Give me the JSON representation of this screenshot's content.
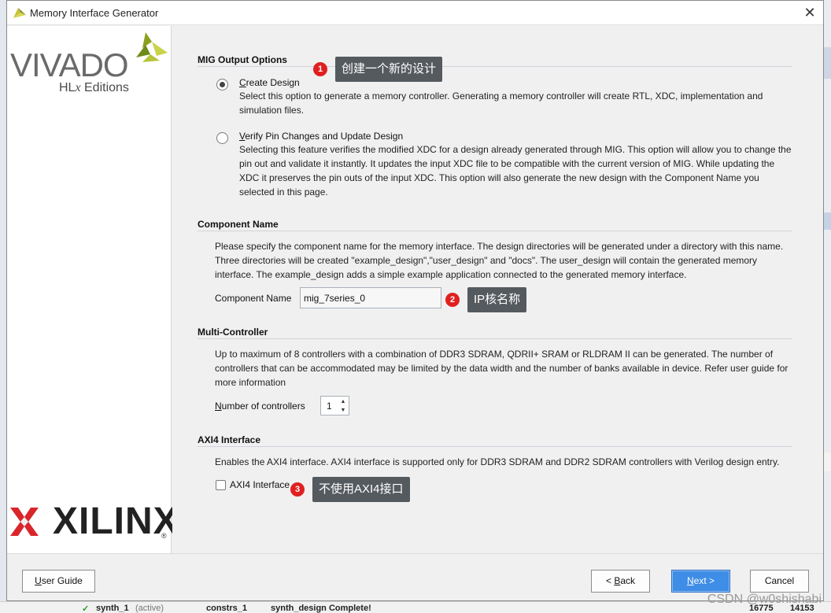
{
  "window": {
    "title": "Memory Interface Generator",
    "close_glyph": "✕"
  },
  "brand": {
    "vivado": "VIVADO",
    "hlx_prefix": "HL",
    "hlx_x": "x",
    "hlx_suffix": " Editions",
    "xilinx": "XILINX",
    "reg": "®"
  },
  "sections": {
    "mig_output": {
      "heading": "MIG Output Options",
      "create": {
        "label_first": "C",
        "label_rest": "reate Design",
        "desc": "Select this option to generate a memory controller. Generating a memory controller will create RTL, XDC, implementation and simulation files.",
        "selected": true
      },
      "verify": {
        "label_first": "V",
        "label_rest": "erify Pin Changes and Update Design",
        "desc": "Selecting this feature verifies the modified XDC for a design already generated through MIG. This option will allow you to change the pin out and validate it instantly. It updates the input XDC file to be compatible with the current version of MIG. While updating the XDC it preserves the pin outs of the input XDC. This option will also generate the new design with the Component Name you selected in this page.",
        "selected": false
      }
    },
    "component": {
      "heading": "Component Name",
      "desc": "Please specify the component name for the memory interface. The design directories will be generated under a directory with this name. Three directories will be created \"example_design\",\"user_design\" and \"docs\". The user_design will contain the generated memory interface. The example_design adds a simple example application connected to the generated memory interface.",
      "field_label": "Component Name",
      "field_value": "mig_7series_0"
    },
    "multi": {
      "heading": "Multi-Controller",
      "desc": "Up to maximum of 8 controllers with a combination of DDR3 SDRAM, QDRII+ SRAM or RLDRAM II can be generated. The number of controllers that can be accommodated may be limited by the data width and the number of banks available in device. Refer user guide for more information",
      "count_label_first": "N",
      "count_label_rest": "umber of controllers",
      "count_value": "1",
      "up_glyph": "▲",
      "down_glyph": "▼"
    },
    "axi": {
      "heading": "AXI4 Interface",
      "desc": "Enables the AXI4 interface. AXI4 interface is supported only for DDR3 SDRAM and DDR2 SDRAM controllers with Verilog design entry.",
      "checkbox_label": "AXI4 Interface",
      "checked": false
    }
  },
  "annotations": {
    "a1": {
      "num": "1",
      "text": "创建一个新的设计"
    },
    "a2": {
      "num": "2",
      "text": "IP核名称"
    },
    "a3": {
      "num": "3",
      "text": "不使用AXI4接口"
    }
  },
  "footer": {
    "user_guide_first": "U",
    "user_guide_rest": "ser Guide",
    "back_prefix": "< ",
    "back_first": "B",
    "back_rest": "ack",
    "next_first": "N",
    "next_rest": "ext >",
    "cancel": "Cancel"
  },
  "background": {
    "row_check": "✓",
    "row_name": "synth_1",
    "row_active": "(active)",
    "row_constrs": "constrs_1",
    "row_status": "synth_design Complete!",
    "row_n1": "16775",
    "row_n2": "14153",
    "watermark": "CSDN @w0shishabi"
  },
  "colors": {
    "accent": "#3e8de6",
    "badge": "#e02020",
    "tip_bg": "#555a5f"
  }
}
